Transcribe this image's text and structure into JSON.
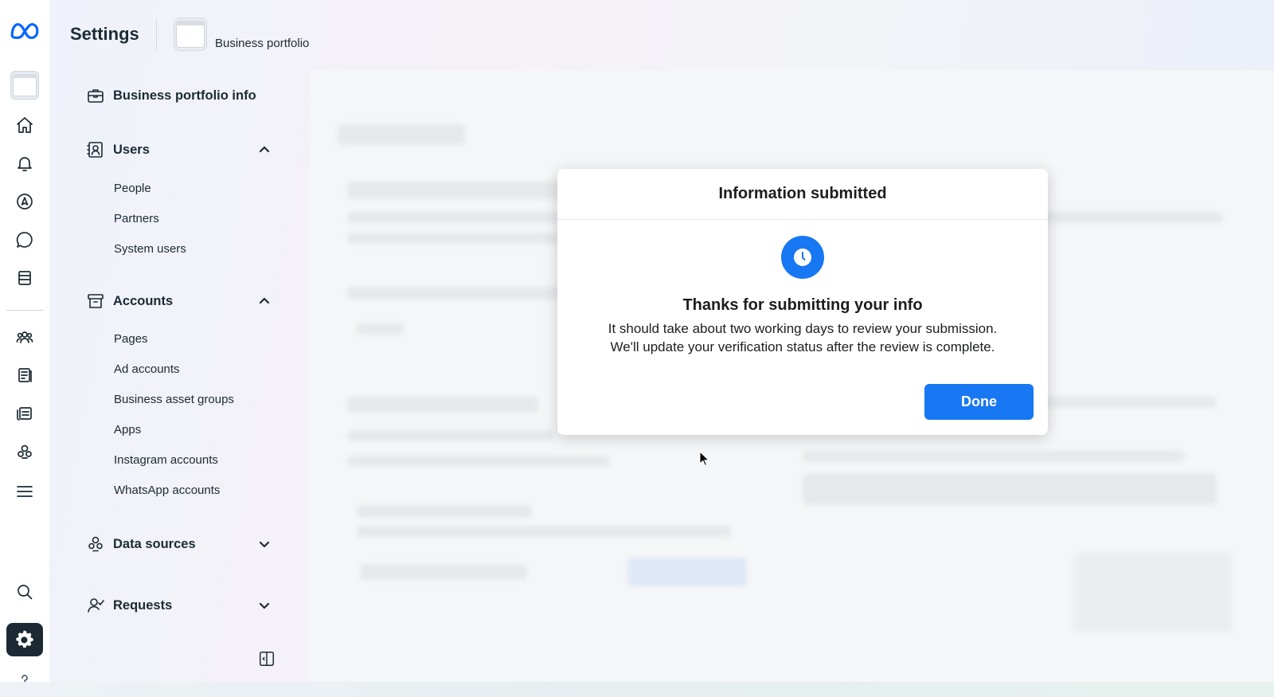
{
  "header": {
    "title": "Settings",
    "portfolio_label": "Business portfolio"
  },
  "nav": {
    "business_info": "Business portfolio info",
    "users": {
      "label": "Users",
      "items": [
        "People",
        "Partners",
        "System users"
      ]
    },
    "accounts": {
      "label": "Accounts",
      "items": [
        "Pages",
        "Ad accounts",
        "Business asset groups",
        "Apps",
        "Instagram accounts",
        "WhatsApp accounts"
      ]
    },
    "data_sources": "Data sources",
    "requests": "Requests"
  },
  "rail_icons": [
    "meta-logo-icon",
    "portfolio-icon",
    "home-icon",
    "notifications-icon",
    "navigation-icon",
    "messages-icon",
    "content-icon",
    "audience-icon",
    "pages-icon",
    "ads-icon",
    "data-icon",
    "menu-icon",
    "search-icon",
    "settings-icon",
    "help-icon"
  ],
  "modal": {
    "title": "Information submitted",
    "heading": "Thanks for submitting your info",
    "body_line1": "It should take about two working days to review your submission.",
    "body_line2": "We'll update your verification status after the review is complete.",
    "done_label": "Done",
    "icon": "clock-icon"
  },
  "colors": {
    "primary": "#1877f2",
    "text": "#1c2b33",
    "active_rail": "#1c2b33"
  }
}
